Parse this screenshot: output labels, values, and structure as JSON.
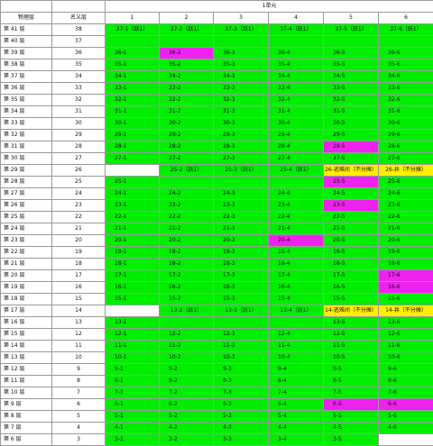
{
  "headers": {
    "unit": "1单元",
    "col_physical": "物理层",
    "col_named": "名义层",
    "columns": [
      "1",
      "2",
      "3",
      "4",
      "5",
      "6"
    ]
  },
  "colors": {
    "green": "#00ee00",
    "magenta": "#ee22ee",
    "yellow": "#ffee00",
    "white": "#ffffff"
  },
  "rows": [
    {
      "phys": "第 41 层",
      "named": "38",
      "cells": [
        {
          "t": "37-1（跃1）",
          "c": "g"
        },
        {
          "t": "37-2（跃1）",
          "c": "g"
        },
        {
          "t": "37-3（跃1）",
          "c": "g"
        },
        {
          "t": "37-4（跃1）",
          "c": "g"
        },
        {
          "t": "37-5（跃1）",
          "c": "g"
        },
        {
          "t": "37-6（跃1）",
          "c": "g"
        }
      ]
    },
    {
      "phys": "第 40 层",
      "named": "37",
      "cells": [
        {
          "t": "",
          "c": "g"
        },
        {
          "t": "",
          "c": "g"
        },
        {
          "t": "",
          "c": "g"
        },
        {
          "t": "",
          "c": "g"
        },
        {
          "t": "",
          "c": "g"
        },
        {
          "t": "",
          "c": "g"
        }
      ]
    },
    {
      "phys": "第 39 层",
      "named": "36",
      "cells": [
        {
          "t": "36-1",
          "c": "g"
        },
        {
          "t": "36-2",
          "c": "m"
        },
        {
          "t": "36-3",
          "c": "g"
        },
        {
          "t": "36-4",
          "c": "g"
        },
        {
          "t": "36-5",
          "c": "g"
        },
        {
          "t": "36-6",
          "c": "g"
        }
      ]
    },
    {
      "phys": "第 38 层",
      "named": "35",
      "cells": [
        {
          "t": "35-1",
          "c": "g"
        },
        {
          "t": "35-2",
          "c": "g"
        },
        {
          "t": "35-3",
          "c": "g"
        },
        {
          "t": "35-4",
          "c": "g"
        },
        {
          "t": "35-5",
          "c": "g"
        },
        {
          "t": "35-6",
          "c": "g"
        }
      ]
    },
    {
      "phys": "第 37 层",
      "named": "34",
      "cells": [
        {
          "t": "34-1",
          "c": "g"
        },
        {
          "t": "34-2",
          "c": "g"
        },
        {
          "t": "34-3",
          "c": "g"
        },
        {
          "t": "34-4",
          "c": "g"
        },
        {
          "t": "34-5",
          "c": "g"
        },
        {
          "t": "34-6",
          "c": "g"
        }
      ]
    },
    {
      "phys": "第 36 层",
      "named": "33",
      "cells": [
        {
          "t": "33-1",
          "c": "g"
        },
        {
          "t": "33-2",
          "c": "g"
        },
        {
          "t": "33-3",
          "c": "g"
        },
        {
          "t": "33-4",
          "c": "g"
        },
        {
          "t": "33-5",
          "c": "g"
        },
        {
          "t": "33-6",
          "c": "g"
        }
      ]
    },
    {
      "phys": "第 35 层",
      "named": "32",
      "cells": [
        {
          "t": "32-1",
          "c": "g"
        },
        {
          "t": "32-2",
          "c": "g"
        },
        {
          "t": "32-3",
          "c": "g"
        },
        {
          "t": "32-4",
          "c": "g"
        },
        {
          "t": "32-5",
          "c": "g"
        },
        {
          "t": "32-6",
          "c": "g"
        }
      ]
    },
    {
      "phys": "第 34 层",
      "named": "31",
      "cells": [
        {
          "t": "31-1",
          "c": "g"
        },
        {
          "t": "31-2",
          "c": "g"
        },
        {
          "t": "31-3",
          "c": "g"
        },
        {
          "t": "31-4",
          "c": "g"
        },
        {
          "t": "31-5",
          "c": "g"
        },
        {
          "t": "31-6",
          "c": "g"
        }
      ]
    },
    {
      "phys": "第 33 层",
      "named": "30",
      "cells": [
        {
          "t": "30-1",
          "c": "g"
        },
        {
          "t": "30-2",
          "c": "g"
        },
        {
          "t": "30-3",
          "c": "g"
        },
        {
          "t": "30-4",
          "c": "g"
        },
        {
          "t": "30-5",
          "c": "g"
        },
        {
          "t": "30-6",
          "c": "g"
        }
      ]
    },
    {
      "phys": "第 32 层",
      "named": "29",
      "cells": [
        {
          "t": "29-1",
          "c": "g"
        },
        {
          "t": "29-2",
          "c": "g"
        },
        {
          "t": "29-3",
          "c": "g"
        },
        {
          "t": "29-4",
          "c": "g"
        },
        {
          "t": "29-5",
          "c": "g"
        },
        {
          "t": "29-6",
          "c": "g"
        }
      ]
    },
    {
      "phys": "第 31 层",
      "named": "28",
      "cells": [
        {
          "t": "28-1",
          "c": "g"
        },
        {
          "t": "28-2",
          "c": "g"
        },
        {
          "t": "28-3",
          "c": "g"
        },
        {
          "t": "28-4",
          "c": "g"
        },
        {
          "t": "28-5",
          "c": "m"
        },
        {
          "t": "28-6",
          "c": "g"
        }
      ]
    },
    {
      "phys": "第 30 层",
      "named": "27",
      "cells": [
        {
          "t": "27-1",
          "c": "g"
        },
        {
          "t": "27-2",
          "c": "g"
        },
        {
          "t": "27-3",
          "c": "g"
        },
        {
          "t": "27-4",
          "c": "g"
        },
        {
          "t": "27-5",
          "c": "g"
        },
        {
          "t": "27-6",
          "c": "g"
        }
      ]
    },
    {
      "phys": "第 29 层",
      "named": "26",
      "cells": [
        {
          "t": "",
          "c": "w"
        },
        {
          "t": "25-2（跃1）",
          "c": "g"
        },
        {
          "t": "25-3（跃1）",
          "c": "g"
        },
        {
          "t": "25-4（跃1）",
          "c": "g"
        },
        {
          "t": "26-逃难间（不分摊）",
          "c": "y"
        },
        {
          "t": "26-井（不分摊）",
          "c": "y"
        }
      ]
    },
    {
      "phys": "第 28 层",
      "named": "25",
      "cells": [
        {
          "t": "25-1",
          "c": "g"
        },
        {
          "t": "",
          "c": "g"
        },
        {
          "t": "",
          "c": "g"
        },
        {
          "t": "",
          "c": "g"
        },
        {
          "t": "25-5",
          "c": "m"
        },
        {
          "t": "25-6",
          "c": "g"
        }
      ]
    },
    {
      "phys": "第 27 层",
      "named": "24",
      "cells": [
        {
          "t": "24-1",
          "c": "g"
        },
        {
          "t": "24-2",
          "c": "g"
        },
        {
          "t": "24-3",
          "c": "g"
        },
        {
          "t": "24-4",
          "c": "g"
        },
        {
          "t": "24-5",
          "c": "g"
        },
        {
          "t": "24-6",
          "c": "g"
        }
      ]
    },
    {
      "phys": "第 26 层",
      "named": "23",
      "cells": [
        {
          "t": "23-1",
          "c": "g"
        },
        {
          "t": "23-2",
          "c": "g"
        },
        {
          "t": "23-3",
          "c": "g"
        },
        {
          "t": "23-4",
          "c": "g"
        },
        {
          "t": "23-5",
          "c": "m"
        },
        {
          "t": "23-6",
          "c": "g"
        }
      ]
    },
    {
      "phys": "第 25 层",
      "named": "22",
      "cells": [
        {
          "t": "22-1",
          "c": "g"
        },
        {
          "t": "22-2",
          "c": "g"
        },
        {
          "t": "22-3",
          "c": "g"
        },
        {
          "t": "22-4",
          "c": "g"
        },
        {
          "t": "22-5",
          "c": "g"
        },
        {
          "t": "22-6",
          "c": "g"
        }
      ]
    },
    {
      "phys": "第 24 层",
      "named": "21",
      "cells": [
        {
          "t": "21-1",
          "c": "g"
        },
        {
          "t": "21-2",
          "c": "g"
        },
        {
          "t": "21-3",
          "c": "g"
        },
        {
          "t": "21-4",
          "c": "g"
        },
        {
          "t": "21-5",
          "c": "g"
        },
        {
          "t": "21-6",
          "c": "g"
        }
      ]
    },
    {
      "phys": "第 23 层",
      "named": "20",
      "cells": [
        {
          "t": "20-1",
          "c": "g"
        },
        {
          "t": "20-2",
          "c": "g"
        },
        {
          "t": "20-3",
          "c": "g"
        },
        {
          "t": "20-4",
          "c": "m"
        },
        {
          "t": "20-5",
          "c": "g"
        },
        {
          "t": "20-6",
          "c": "g"
        }
      ]
    },
    {
      "phys": "第 22 层",
      "named": "19",
      "cells": [
        {
          "t": "19-1",
          "c": "g"
        },
        {
          "t": "19-2",
          "c": "g"
        },
        {
          "t": "19-3",
          "c": "g"
        },
        {
          "t": "19-4",
          "c": "g"
        },
        {
          "t": "19-5",
          "c": "g"
        },
        {
          "t": "19-6",
          "c": "g"
        }
      ]
    },
    {
      "phys": "第 21 层",
      "named": "18",
      "cells": [
        {
          "t": "18-1",
          "c": "g"
        },
        {
          "t": "18-2",
          "c": "g"
        },
        {
          "t": "18-3",
          "c": "g"
        },
        {
          "t": "18-4",
          "c": "g"
        },
        {
          "t": "18-5",
          "c": "g"
        },
        {
          "t": "18-6",
          "c": "g"
        }
      ]
    },
    {
      "phys": "第 20 层",
      "named": "17",
      "cells": [
        {
          "t": "17-1",
          "c": "g"
        },
        {
          "t": "17-2",
          "c": "g"
        },
        {
          "t": "17-3",
          "c": "g"
        },
        {
          "t": "17-4",
          "c": "g"
        },
        {
          "t": "17-5",
          "c": "g"
        },
        {
          "t": "17-6",
          "c": "m"
        }
      ]
    },
    {
      "phys": "第 19 层",
      "named": "16",
      "cells": [
        {
          "t": "16-1",
          "c": "g"
        },
        {
          "t": "16-2",
          "c": "g"
        },
        {
          "t": "16-3",
          "c": "g"
        },
        {
          "t": "16-4",
          "c": "g"
        },
        {
          "t": "16-5",
          "c": "g"
        },
        {
          "t": "16-6",
          "c": "m"
        }
      ]
    },
    {
      "phys": "第 18 层",
      "named": "15",
      "cells": [
        {
          "t": "15-1",
          "c": "g"
        },
        {
          "t": "15-2",
          "c": "g"
        },
        {
          "t": "15-3",
          "c": "g"
        },
        {
          "t": "15-4",
          "c": "g"
        },
        {
          "t": "15-5",
          "c": "g"
        },
        {
          "t": "15-6",
          "c": "g"
        }
      ]
    },
    {
      "phys": "第 17 层",
      "named": "14",
      "cells": [
        {
          "t": "",
          "c": "w"
        },
        {
          "t": "13-2（跃1）",
          "c": "g"
        },
        {
          "t": "13-3（跃1）",
          "c": "g"
        },
        {
          "t": "13-4（跃1）",
          "c": "g"
        },
        {
          "t": "14-逃难间（不分摊）",
          "c": "y"
        },
        {
          "t": "14-井（不分摊）",
          "c": "y"
        }
      ]
    },
    {
      "phys": "第 16 层",
      "named": "13",
      "cells": [
        {
          "t": "13-1",
          "c": "g"
        },
        {
          "t": "",
          "c": "g"
        },
        {
          "t": "",
          "c": "g"
        },
        {
          "t": "",
          "c": "g"
        },
        {
          "t": "13-5",
          "c": "g"
        },
        {
          "t": "13-6",
          "c": "g"
        }
      ]
    },
    {
      "phys": "第 15 层",
      "named": "12",
      "cells": [
        {
          "t": "12-1",
          "c": "g"
        },
        {
          "t": "12-2",
          "c": "g"
        },
        {
          "t": "12-3",
          "c": "g"
        },
        {
          "t": "12-4",
          "c": "g"
        },
        {
          "t": "12-5",
          "c": "g"
        },
        {
          "t": "12-6",
          "c": "g"
        }
      ]
    },
    {
      "phys": "第 14 层",
      "named": "11",
      "cells": [
        {
          "t": "11-1",
          "c": "g"
        },
        {
          "t": "11-2",
          "c": "g"
        },
        {
          "t": "11-3",
          "c": "g"
        },
        {
          "t": "11-4",
          "c": "g"
        },
        {
          "t": "11-5",
          "c": "g"
        },
        {
          "t": "11-6",
          "c": "g"
        }
      ]
    },
    {
      "phys": "第 13 层",
      "named": "10",
      "cells": [
        {
          "t": "10-1",
          "c": "g"
        },
        {
          "t": "10-2",
          "c": "g"
        },
        {
          "t": "10-3",
          "c": "g"
        },
        {
          "t": "10-4",
          "c": "g"
        },
        {
          "t": "10-5",
          "c": "g"
        },
        {
          "t": "10-6",
          "c": "g"
        }
      ]
    },
    {
      "phys": "第 12 层",
      "named": "9",
      "cells": [
        {
          "t": "9-1",
          "c": "g"
        },
        {
          "t": "9-2",
          "c": "g"
        },
        {
          "t": "9-3",
          "c": "g"
        },
        {
          "t": "9-4",
          "c": "g"
        },
        {
          "t": "9-5",
          "c": "g"
        },
        {
          "t": "9-6",
          "c": "g"
        }
      ]
    },
    {
      "phys": "第 11 层",
      "named": "8",
      "cells": [
        {
          "t": "8-1",
          "c": "g"
        },
        {
          "t": "8-2",
          "c": "g"
        },
        {
          "t": "8-3",
          "c": "g"
        },
        {
          "t": "8-4",
          "c": "g"
        },
        {
          "t": "8-5",
          "c": "g"
        },
        {
          "t": "8-6",
          "c": "g"
        }
      ]
    },
    {
      "phys": "第 10 层",
      "named": "7",
      "cells": [
        {
          "t": "7-1",
          "c": "g"
        },
        {
          "t": "7-2",
          "c": "g"
        },
        {
          "t": "7-3",
          "c": "g"
        },
        {
          "t": "7-4",
          "c": "g"
        },
        {
          "t": "7-5",
          "c": "g"
        },
        {
          "t": "7-6",
          "c": "g"
        }
      ]
    },
    {
      "phys": "第 9 层",
      "named": "6",
      "cells": [
        {
          "t": "6-1",
          "c": "g"
        },
        {
          "t": "6-2",
          "c": "g"
        },
        {
          "t": "6-3",
          "c": "g"
        },
        {
          "t": "6-4",
          "c": "g"
        },
        {
          "t": "6-5",
          "c": "m"
        },
        {
          "t": "6-6",
          "c": "m"
        }
      ]
    },
    {
      "phys": "第 8 层",
      "named": "5",
      "cells": [
        {
          "t": "5-1",
          "c": "g"
        },
        {
          "t": "5-2",
          "c": "g"
        },
        {
          "t": "5-3",
          "c": "g"
        },
        {
          "t": "5-4",
          "c": "g"
        },
        {
          "t": "5-5",
          "c": "g"
        },
        {
          "t": "5-6",
          "c": "g"
        }
      ]
    },
    {
      "phys": "第 7 层",
      "named": "4",
      "cells": [
        {
          "t": "4-1",
          "c": "g"
        },
        {
          "t": "4-2",
          "c": "g"
        },
        {
          "t": "4-3",
          "c": "g"
        },
        {
          "t": "4-4",
          "c": "g"
        },
        {
          "t": "4-5",
          "c": "g"
        },
        {
          "t": "4-6",
          "c": "g"
        }
      ]
    },
    {
      "phys": "第 6 层",
      "named": "3",
      "cells": [
        {
          "t": "3-1",
          "c": "g"
        },
        {
          "t": "3-2",
          "c": "g"
        },
        {
          "t": "3-3",
          "c": "g"
        },
        {
          "t": "3-4",
          "c": "g"
        },
        {
          "t": "3-5",
          "c": "g"
        },
        {
          "t": "",
          "c": "w"
        }
      ]
    }
  ]
}
